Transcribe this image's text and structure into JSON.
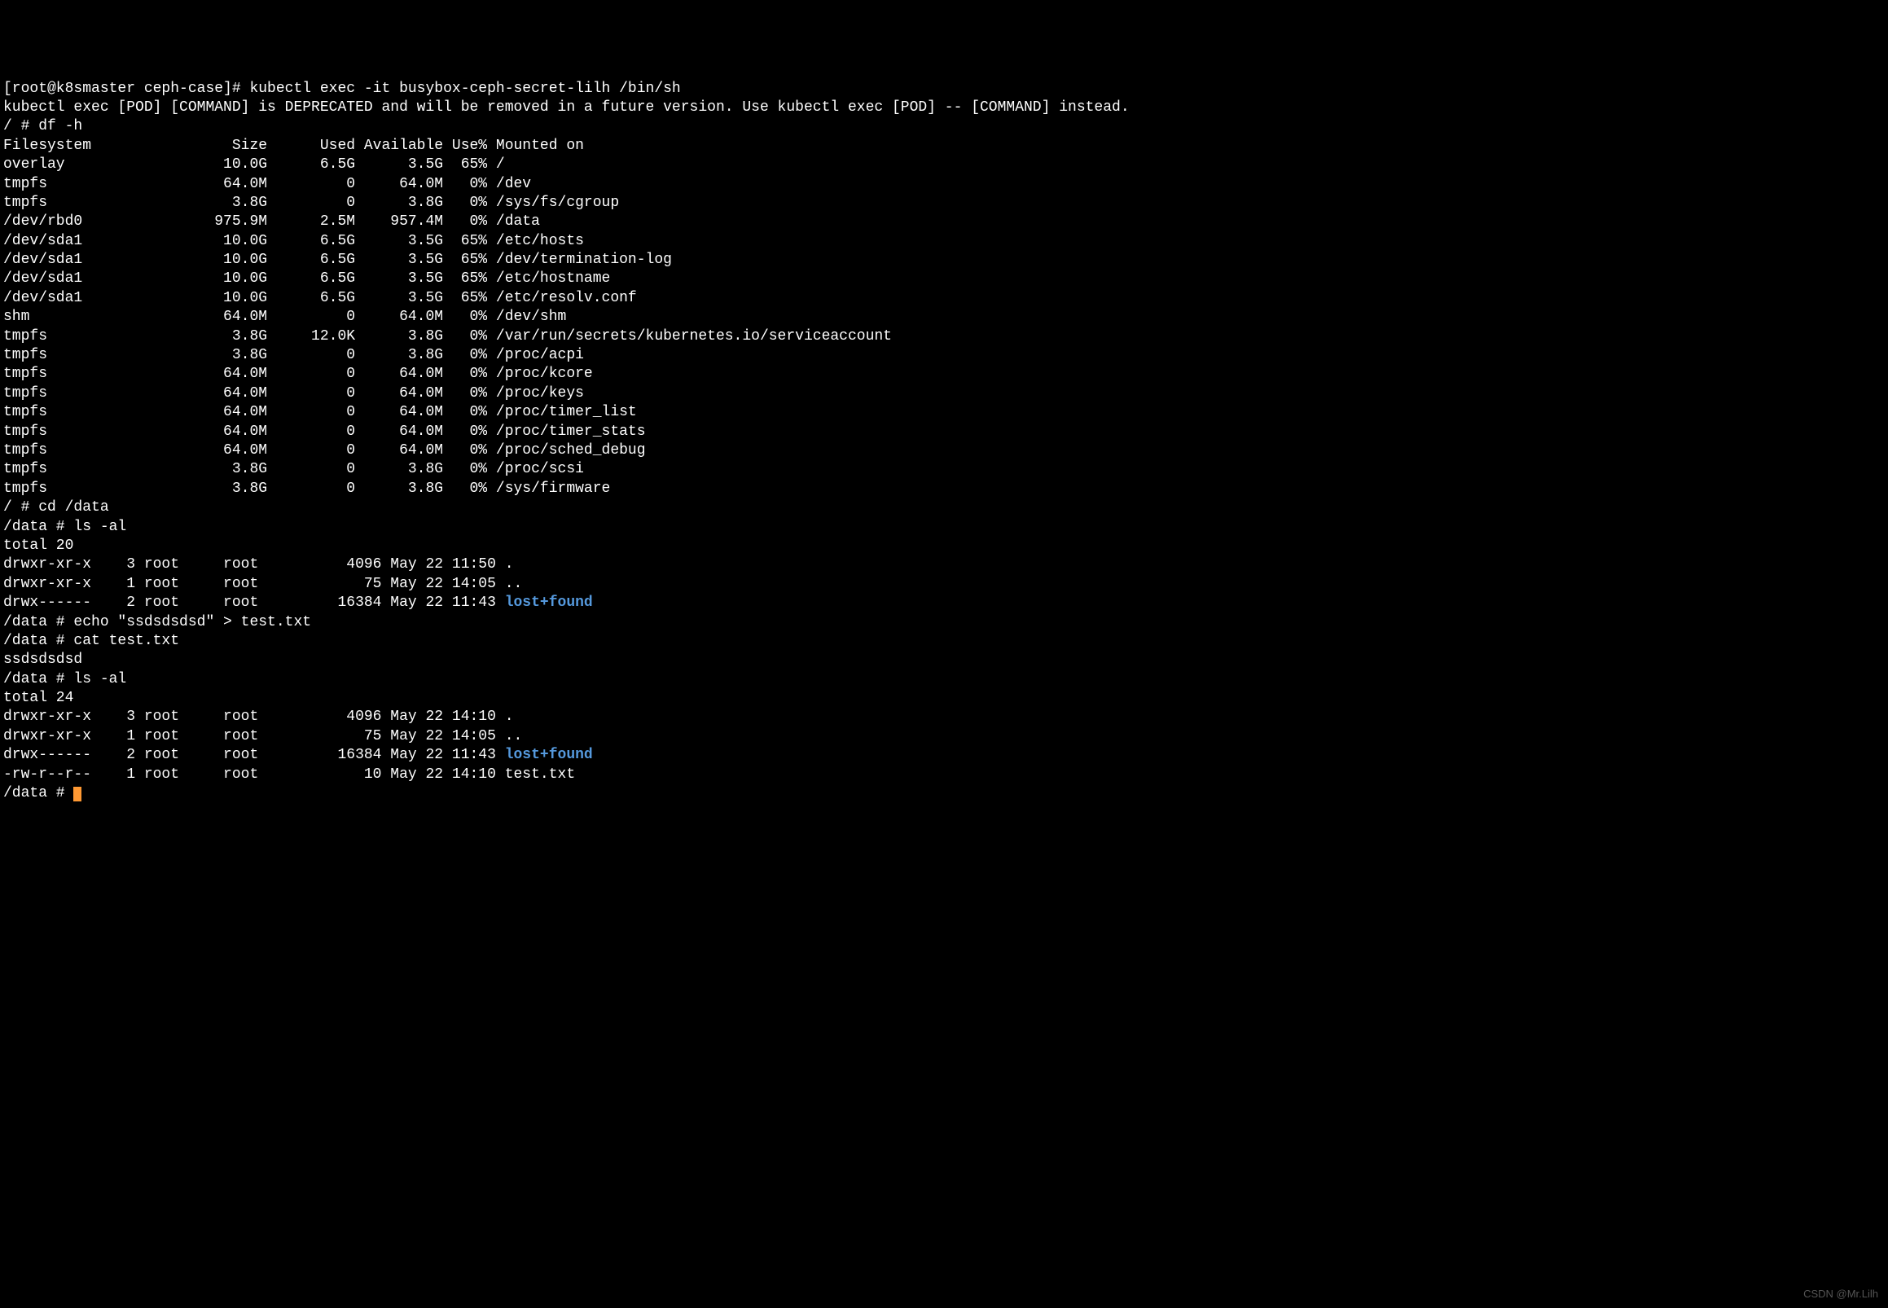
{
  "lines": [
    {
      "segments": [
        {
          "text": "[root@k8smaster ceph-case]# kubectl exec -it busybox-ceph-secret-lilh /bin/sh"
        }
      ]
    },
    {
      "segments": [
        {
          "text": "kubectl exec [POD] [COMMAND] is DEPRECATED and will be removed in a future version. Use kubectl exec [POD] -- [COMMAND] instead."
        }
      ]
    },
    {
      "segments": [
        {
          "text": "/ # df -h"
        }
      ]
    },
    {
      "segments": [
        {
          "text": "Filesystem                Size      Used Available Use% Mounted on"
        }
      ]
    },
    {
      "segments": [
        {
          "text": "overlay                  10.0G      6.5G      3.5G  65% /"
        }
      ]
    },
    {
      "segments": [
        {
          "text": "tmpfs                    64.0M         0     64.0M   0% /dev"
        }
      ]
    },
    {
      "segments": [
        {
          "text": "tmpfs                     3.8G         0      3.8G   0% /sys/fs/cgroup"
        }
      ]
    },
    {
      "segments": [
        {
          "text": "/dev/rbd0               975.9M      2.5M    957.4M   0% /data"
        }
      ]
    },
    {
      "segments": [
        {
          "text": "/dev/sda1                10.0G      6.5G      3.5G  65% /etc/hosts"
        }
      ]
    },
    {
      "segments": [
        {
          "text": "/dev/sda1                10.0G      6.5G      3.5G  65% /dev/termination-log"
        }
      ]
    },
    {
      "segments": [
        {
          "text": "/dev/sda1                10.0G      6.5G      3.5G  65% /etc/hostname"
        }
      ]
    },
    {
      "segments": [
        {
          "text": "/dev/sda1                10.0G      6.5G      3.5G  65% /etc/resolv.conf"
        }
      ]
    },
    {
      "segments": [
        {
          "text": "shm                      64.0M         0     64.0M   0% /dev/shm"
        }
      ]
    },
    {
      "segments": [
        {
          "text": "tmpfs                     3.8G     12.0K      3.8G   0% /var/run/secrets/kubernetes.io/serviceaccount"
        }
      ]
    },
    {
      "segments": [
        {
          "text": "tmpfs                     3.8G         0      3.8G   0% /proc/acpi"
        }
      ]
    },
    {
      "segments": [
        {
          "text": "tmpfs                    64.0M         0     64.0M   0% /proc/kcore"
        }
      ]
    },
    {
      "segments": [
        {
          "text": "tmpfs                    64.0M         0     64.0M   0% /proc/keys"
        }
      ]
    },
    {
      "segments": [
        {
          "text": "tmpfs                    64.0M         0     64.0M   0% /proc/timer_list"
        }
      ]
    },
    {
      "segments": [
        {
          "text": "tmpfs                    64.0M         0     64.0M   0% /proc/timer_stats"
        }
      ]
    },
    {
      "segments": [
        {
          "text": "tmpfs                    64.0M         0     64.0M   0% /proc/sched_debug"
        }
      ]
    },
    {
      "segments": [
        {
          "text": "tmpfs                     3.8G         0      3.8G   0% /proc/scsi"
        }
      ]
    },
    {
      "segments": [
        {
          "text": "tmpfs                     3.8G         0      3.8G   0% /sys/firmware"
        }
      ]
    },
    {
      "segments": [
        {
          "text": "/ # cd /data"
        }
      ]
    },
    {
      "segments": [
        {
          "text": "/data # ls -al"
        }
      ]
    },
    {
      "segments": [
        {
          "text": "total 20"
        }
      ]
    },
    {
      "segments": [
        {
          "text": "drwxr-xr-x    3 root     root          4096 May 22 11:50 ."
        }
      ]
    },
    {
      "segments": [
        {
          "text": "drwxr-xr-x    1 root     root            75 May 22 14:05 .."
        }
      ]
    },
    {
      "segments": [
        {
          "text": "drwx------    2 root     root         16384 May 22 11:43 "
        },
        {
          "text": "lost+found",
          "class": "highlight"
        }
      ]
    },
    {
      "segments": [
        {
          "text": "/data # echo \"ssdsdsdsd\" > test.txt"
        }
      ]
    },
    {
      "segments": [
        {
          "text": "/data # cat test.txt"
        }
      ]
    },
    {
      "segments": [
        {
          "text": "ssdsdsdsd"
        }
      ]
    },
    {
      "segments": [
        {
          "text": "/data # ls -al"
        }
      ]
    },
    {
      "segments": [
        {
          "text": "total 24"
        }
      ]
    },
    {
      "segments": [
        {
          "text": "drwxr-xr-x    3 root     root          4096 May 22 14:10 ."
        }
      ]
    },
    {
      "segments": [
        {
          "text": "drwxr-xr-x    1 root     root            75 May 22 14:05 .."
        }
      ]
    },
    {
      "segments": [
        {
          "text": "drwx------    2 root     root         16384 May 22 11:43 "
        },
        {
          "text": "lost+found",
          "class": "highlight"
        }
      ]
    },
    {
      "segments": [
        {
          "text": "-rw-r--r--    1 root     root            10 May 22 14:10 test.txt"
        }
      ]
    },
    {
      "segments": [
        {
          "text": "/data # "
        },
        {
          "cursor": true
        }
      ]
    }
  ],
  "watermark": "CSDN @Mr.Lilh"
}
